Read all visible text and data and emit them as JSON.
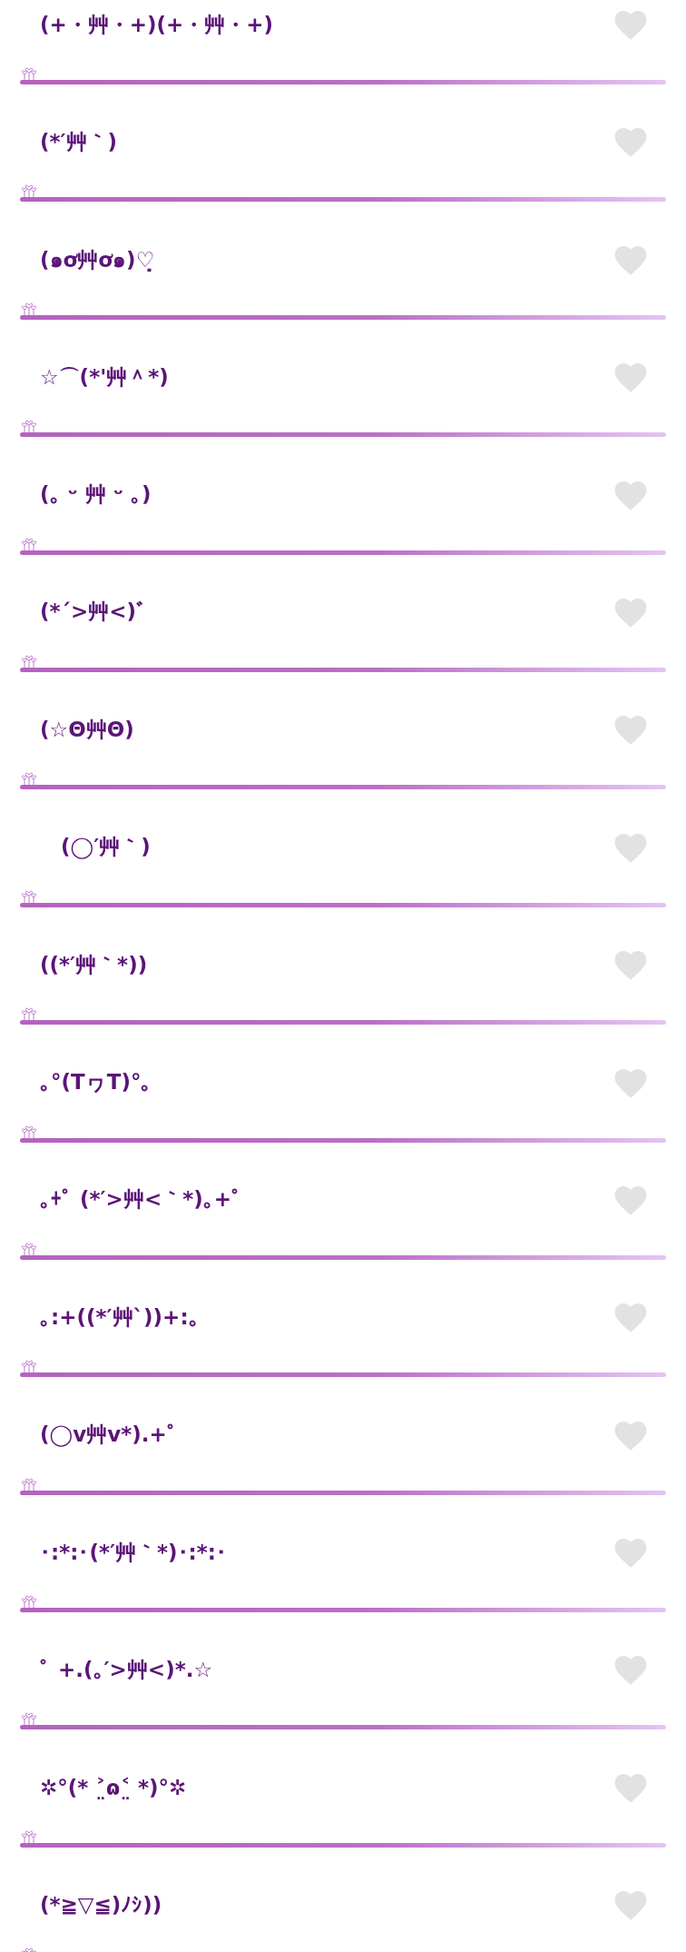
{
  "items": [
    {
      "text": "(+・艸・+)(+・艸・+)",
      "liked": false
    },
    {
      "text": "(*′艸｀)",
      "liked": false
    },
    {
      "text": "(๑ơ艸ơ๑)♡̣",
      "liked": false
    },
    {
      "text": "☆⌒(*'艸＾*)",
      "liked": false
    },
    {
      "text": "(｡ ᵕ 艸 ᵕ ｡)",
      "liked": false
    },
    {
      "text": "(*ˊ>艸<)ﾞ",
      "liked": false
    },
    {
      "text": "(☆Θ艸Θ)",
      "liked": false
    },
    {
      "text": "　(◯′艸｀)",
      "liked": false
    },
    {
      "text": "((*′艸｀*))",
      "liked": false
    },
    {
      "text": "｡°(ТヮТ)°｡",
      "liked": false
    },
    {
      "text": "｡+ﾟ (*′>艸<｀*)｡+ﾟ",
      "liked": false
    },
    {
      "text": "｡:+((*′艸`))+:｡",
      "liked": false
    },
    {
      "text": "(◯v艸v*).+ﾟ",
      "liked": false
    },
    {
      "text": "･:*:･(*′艸｀*)･:*:･",
      "liked": false
    },
    {
      "text": "ﾟ +.(｡′>艸<)*.☆",
      "liked": false
    },
    {
      "text": "✲°(* ˃̤ɷ˂̤ *)°✲",
      "liked": false
    },
    {
      "text": "(*≧▽≦)ﾉｼ))",
      "liked": false
    }
  ]
}
